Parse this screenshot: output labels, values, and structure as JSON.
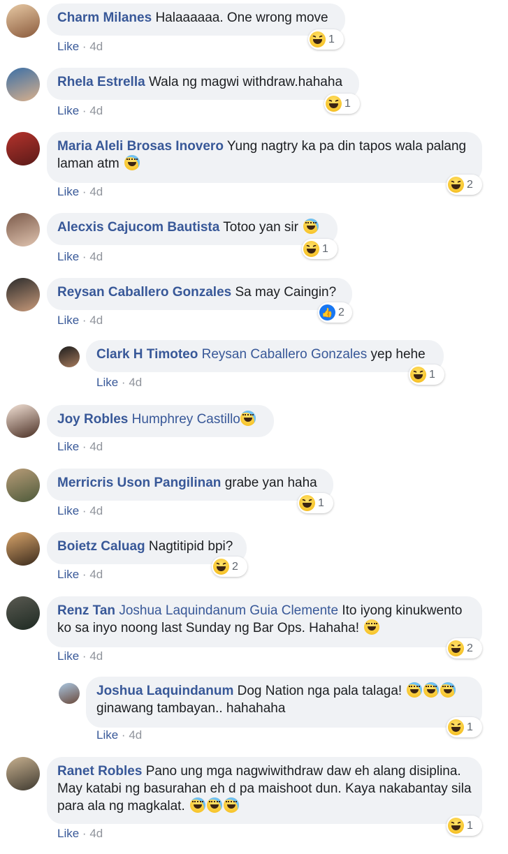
{
  "like_label": "Like",
  "dot": "·",
  "comments": [
    {
      "name": "Charm Milanes",
      "tag": "",
      "text": "Halaaaaaa. One wrong move",
      "time": "4d",
      "reaction": "haha",
      "count": "1"
    },
    {
      "name": "Rhela Estrella",
      "tag": "",
      "text": "Wala ng magwi withdraw.hahaha",
      "time": "4d",
      "reaction": "haha",
      "count": "1"
    },
    {
      "name": "Maria Aleli Brosas Inovero",
      "tag": "",
      "text": "Yung nagtry ka pa din tapos wala palang laman atm",
      "emoji": "joy",
      "time": "4d",
      "reaction": "haha",
      "count": "2"
    },
    {
      "name": "Alecxis Cajucom Bautista",
      "tag": "",
      "text": "Totoo yan sir",
      "emoji": "joy",
      "time": "4d",
      "reaction": "haha",
      "count": "1"
    },
    {
      "name": "Reysan Caballero Gonzales",
      "tag": "",
      "text": "Sa may Caingin?",
      "time": "4d",
      "reaction": "like",
      "count": "2"
    },
    {
      "name": "Clark H Timoteo",
      "tag": "Reysan Caballero Gonzales",
      "text": "yep hehe",
      "time": "4d",
      "reaction": "haha",
      "count": "1"
    },
    {
      "name": "Joy Robles",
      "tag": "Humphrey Castillo",
      "text": "",
      "emoji": "joy",
      "time": "4d",
      "reaction": "",
      "count": ""
    },
    {
      "name": "Merricris Uson Pangilinan",
      "tag": "",
      "text": "grabe yan haha",
      "time": "4d",
      "reaction": "haha",
      "count": "1"
    },
    {
      "name": "Boietz Caluag",
      "tag": "",
      "text": "Nagtitipid bpi?",
      "time": "4d",
      "reaction": "haha",
      "count": "2"
    },
    {
      "name": "Renz Tan",
      "tag": "Joshua Laquindanum Guia Clemente",
      "text": "Ito iyong kinukwento ko sa inyo noong last Sunday ng Bar Ops. Hahaha!",
      "emoji": "grin",
      "time": "4d",
      "reaction": "haha",
      "count": "2"
    },
    {
      "name": "Joshua Laquindanum",
      "tag": "",
      "text": "Dog Nation nga pala talaga!",
      "emoji": "rofl3",
      "text2": "ginawang tambayan.. hahahaha",
      "time": "4d",
      "reaction": "haha",
      "count": "1"
    },
    {
      "name": "Ranet Robles",
      "tag": "",
      "text": "Pano ung mga nagwiwithdraw daw eh alang disiplina. May katabi ng basurahan eh d pa maishoot dun. Kaya nakabantay sila para ala ng magkalat.",
      "emoji": "joy3",
      "time": "4d",
      "reaction": "haha",
      "count": "1"
    }
  ],
  "colors": {
    "name": "#385898",
    "bubble": "#f0f2f5",
    "meta": "#90949c",
    "like": "#1877f2"
  }
}
